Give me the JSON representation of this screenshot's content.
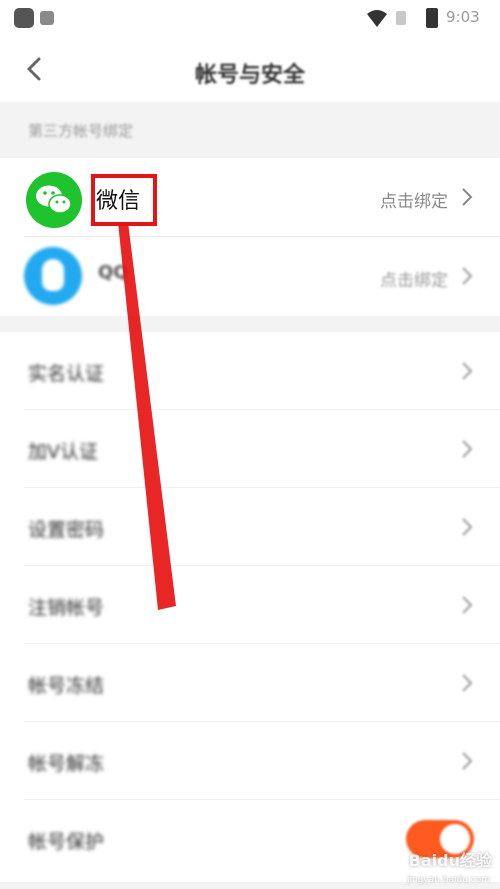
{
  "status_bar": {
    "time": "9:03"
  },
  "nav": {
    "title": "帐号与安全"
  },
  "section": {
    "label": "第三方帐号绑定"
  },
  "bindings": [
    {
      "name": "微信",
      "action": "点击绑定",
      "icon": "wechat-icon"
    },
    {
      "name": "QQ",
      "action": "点击绑定",
      "icon": "qq-icon"
    }
  ],
  "settings": [
    {
      "label": "实名认证"
    },
    {
      "label": "加V认证"
    },
    {
      "label": "设置密码"
    },
    {
      "label": "注销帐号"
    },
    {
      "label": "帐号冻结"
    },
    {
      "label": "帐号解冻"
    },
    {
      "label": "帐号保护",
      "toggle": true
    }
  ],
  "watermark": {
    "text": "Baidu经验",
    "sub": "jingyan.baidu.com"
  },
  "colors": {
    "wechat": "#1ec32d",
    "qq": "#22a9f0",
    "toggle_on": "#ff5a1f",
    "annotation": "#e61414"
  }
}
